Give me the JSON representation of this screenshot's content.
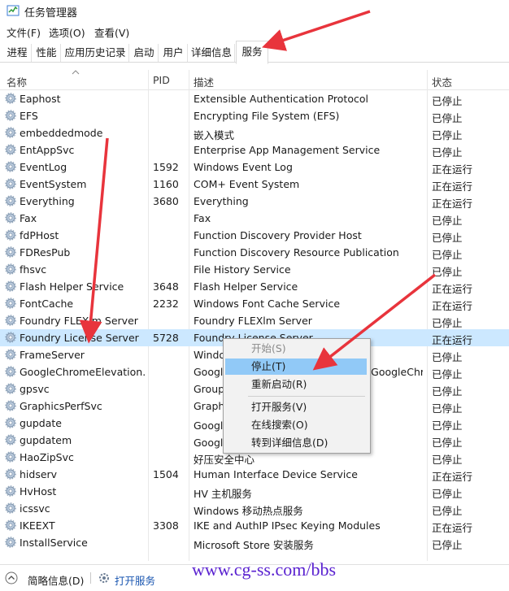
{
  "window": {
    "title": "任务管理器"
  },
  "menu": [
    "文件(F)",
    "选项(O)",
    "查看(V)"
  ],
  "tabs": [
    "进程",
    "性能",
    "应用历史记录",
    "启动",
    "用户",
    "详细信息",
    "服务"
  ],
  "active_tab": "服务",
  "columns": {
    "name": "名称",
    "pid": "PID",
    "desc": "描述",
    "status": "状态"
  },
  "rows": [
    {
      "name": "Eaphost",
      "pid": "",
      "desc": "Extensible Authentication Protocol",
      "status": "已停止"
    },
    {
      "name": "EFS",
      "pid": "",
      "desc": "Encrypting File System (EFS)",
      "status": "已停止"
    },
    {
      "name": "embeddedmode",
      "pid": "",
      "desc": "嵌入模式",
      "status": "已停止"
    },
    {
      "name": "EntAppSvc",
      "pid": "",
      "desc": "Enterprise App Management Service",
      "status": "已停止"
    },
    {
      "name": "EventLog",
      "pid": "1592",
      "desc": "Windows Event Log",
      "status": "正在运行"
    },
    {
      "name": "EventSystem",
      "pid": "1160",
      "desc": "COM+ Event System",
      "status": "正在运行"
    },
    {
      "name": "Everything",
      "pid": "3680",
      "desc": "Everything",
      "status": "正在运行"
    },
    {
      "name": "Fax",
      "pid": "",
      "desc": "Fax",
      "status": "已停止"
    },
    {
      "name": "fdPHost",
      "pid": "",
      "desc": "Function Discovery Provider Host",
      "status": "已停止"
    },
    {
      "name": "FDResPub",
      "pid": "",
      "desc": "Function Discovery Resource Publication",
      "status": "已停止"
    },
    {
      "name": "fhsvc",
      "pid": "",
      "desc": "File History Service",
      "status": "已停止"
    },
    {
      "name": "Flash Helper Service",
      "pid": "3648",
      "desc": "Flash Helper Service",
      "status": "正在运行"
    },
    {
      "name": "FontCache",
      "pid": "2232",
      "desc": "Windows Font Cache Service",
      "status": "正在运行"
    },
    {
      "name": "Foundry FLEXlm Server",
      "pid": "",
      "desc": "Foundry FLEXlm Server",
      "status": "已停止"
    },
    {
      "name": "Foundry License Server",
      "pid": "5728",
      "desc": "Foundry License Server",
      "status": "正在运行"
    },
    {
      "name": "FrameServer",
      "pid": "",
      "desc": "Windows Camera Frame Server",
      "status": "已停止"
    },
    {
      "name": "GoogleChromeElevation…",
      "pid": "",
      "desc": "Google Chrome Elevation Service (GoogleChr…",
      "status": "已停止"
    },
    {
      "name": "gpsvc",
      "pid": "",
      "desc": "Group Policy Client",
      "status": "已停止"
    },
    {
      "name": "GraphicsPerfSvc",
      "pid": "",
      "desc": "GraphicsPerfSvc",
      "status": "已停止"
    },
    {
      "name": "gupdate",
      "pid": "",
      "desc": "Google 更新服务 (gupdate)",
      "status": "已停止"
    },
    {
      "name": "gupdatem",
      "pid": "",
      "desc": "Google 更新服务 (gupdatem)",
      "status": "已停止"
    },
    {
      "name": "HaoZipSvc",
      "pid": "",
      "desc": "好压安全中心",
      "status": "已停止"
    },
    {
      "name": "hidserv",
      "pid": "1504",
      "desc": "Human Interface Device Service",
      "status": "正在运行"
    },
    {
      "name": "HvHost",
      "pid": "",
      "desc": "HV 主机服务",
      "status": "已停止"
    },
    {
      "name": "icssvc",
      "pid": "",
      "desc": "Windows 移动热点服务",
      "status": "已停止"
    },
    {
      "name": "IKEEXT",
      "pid": "3308",
      "desc": "IKE and AuthIP IPsec Keying Modules",
      "status": "正在运行"
    },
    {
      "name": "InstallService",
      "pid": "",
      "desc": "Microsoft Store 安装服务",
      "status": "已停止"
    }
  ],
  "selected_row": 14,
  "context_menu": [
    "开始(S)",
    "停止(T)",
    "重新启动(R)",
    "打开服务(V)",
    "在线搜索(O)",
    "转到详细信息(D)"
  ],
  "statusbar": {
    "brief": "简略信息(D)",
    "open_services": "打开服务"
  },
  "watermark": "www.cg-ss.com/bbs",
  "colors": {
    "selected_row": "#cce8ff",
    "menu_highlight": "#91c9f7",
    "arrow": "#e8343c",
    "watermark": "#5a22d0"
  }
}
